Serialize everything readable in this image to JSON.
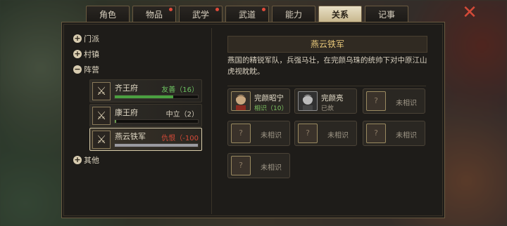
{
  "tabs": [
    "角色",
    "物品",
    "武学",
    "武道",
    "能力",
    "关系",
    "记事"
  ],
  "tree": {
    "groups": [
      "门派",
      "村镇",
      "阵营",
      "其他"
    ],
    "factions": [
      {
        "name": "齐王府",
        "status": "友善（16）",
        "status_color": "#6cc060",
        "bar_fraction": 0.7,
        "bar_color": "#4aa040"
      },
      {
        "name": "康王府",
        "status": "中立（2）",
        "status_color": "#d8d0bf",
        "bar_fraction": 0.02,
        "bar_color": "#6a9a50"
      },
      {
        "name": "燕云铁军",
        "status": "仇恨（-100",
        "status_color": "#d44a38",
        "bar_fraction": 1.0,
        "bar_color": "#9a9aa0"
      }
    ]
  },
  "detail": {
    "title": "燕云铁军",
    "description": "燕国的精锐军队，兵强马壮，在完颜乌珠的统帅下对中原江山虎视眈眈。",
    "members": [
      {
        "name": "完颜昭宁",
        "sub": "相识（10）",
        "sub_color": "#7cc060",
        "known": true
      },
      {
        "name": "完颜亮",
        "sub": "已故",
        "sub_color": "#a09888",
        "known": true
      },
      {
        "name": "未相识",
        "known": false
      },
      {
        "name": "未相识",
        "known": false
      },
      {
        "name": "未相识",
        "known": false
      },
      {
        "name": "未相识",
        "known": false
      },
      {
        "name": "未相识",
        "known": false
      }
    ]
  }
}
